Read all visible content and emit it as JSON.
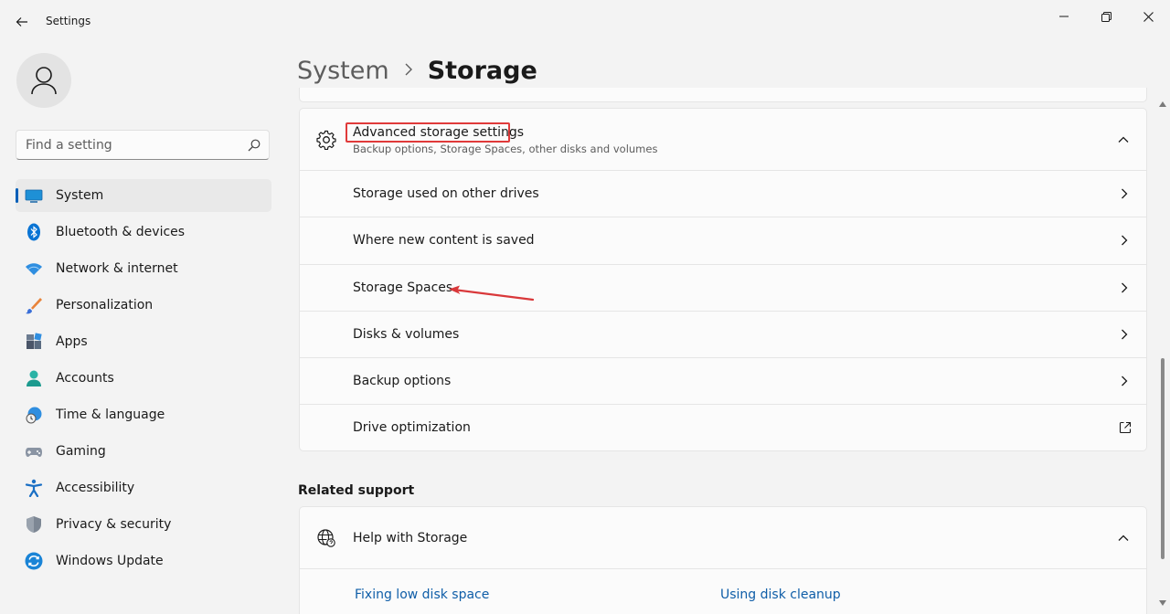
{
  "window": {
    "title": "Settings"
  },
  "sidebar": {
    "search_placeholder": "Find a setting",
    "items": [
      {
        "label": "System",
        "icon": "system-icon",
        "selected": true
      },
      {
        "label": "Bluetooth & devices",
        "icon": "bluetooth-icon"
      },
      {
        "label": "Network & internet",
        "icon": "wifi-icon"
      },
      {
        "label": "Personalization",
        "icon": "brush-icon"
      },
      {
        "label": "Apps",
        "icon": "apps-icon"
      },
      {
        "label": "Accounts",
        "icon": "accounts-icon"
      },
      {
        "label": "Time & language",
        "icon": "time-language-icon"
      },
      {
        "label": "Gaming",
        "icon": "gamepad-icon"
      },
      {
        "label": "Accessibility",
        "icon": "accessibility-icon"
      },
      {
        "label": "Privacy & security",
        "icon": "shield-icon"
      },
      {
        "label": "Windows Update",
        "icon": "update-icon"
      }
    ]
  },
  "breadcrumb": {
    "parent": "System",
    "separator": ">",
    "current": "Storage"
  },
  "advanced": {
    "title": "Advanced storage settings",
    "subtitle": "Backup options, Storage Spaces, other disks and volumes",
    "rows": [
      {
        "label": "Storage used on other drives",
        "type": "chevron"
      },
      {
        "label": "Where new content is saved",
        "type": "chevron"
      },
      {
        "label": "Storage Spaces",
        "type": "chevron"
      },
      {
        "label": "Disks & volumes",
        "type": "chevron"
      },
      {
        "label": "Backup options",
        "type": "chevron"
      },
      {
        "label": "Drive optimization",
        "type": "external"
      }
    ]
  },
  "related": {
    "heading": "Related support",
    "help_title": "Help with Storage",
    "links": [
      "Fixing low disk space",
      "Using disk cleanup"
    ]
  },
  "colors": {
    "accent": "#005fb8",
    "annotation": "#e03a3a",
    "link": "#0f5ea8"
  }
}
